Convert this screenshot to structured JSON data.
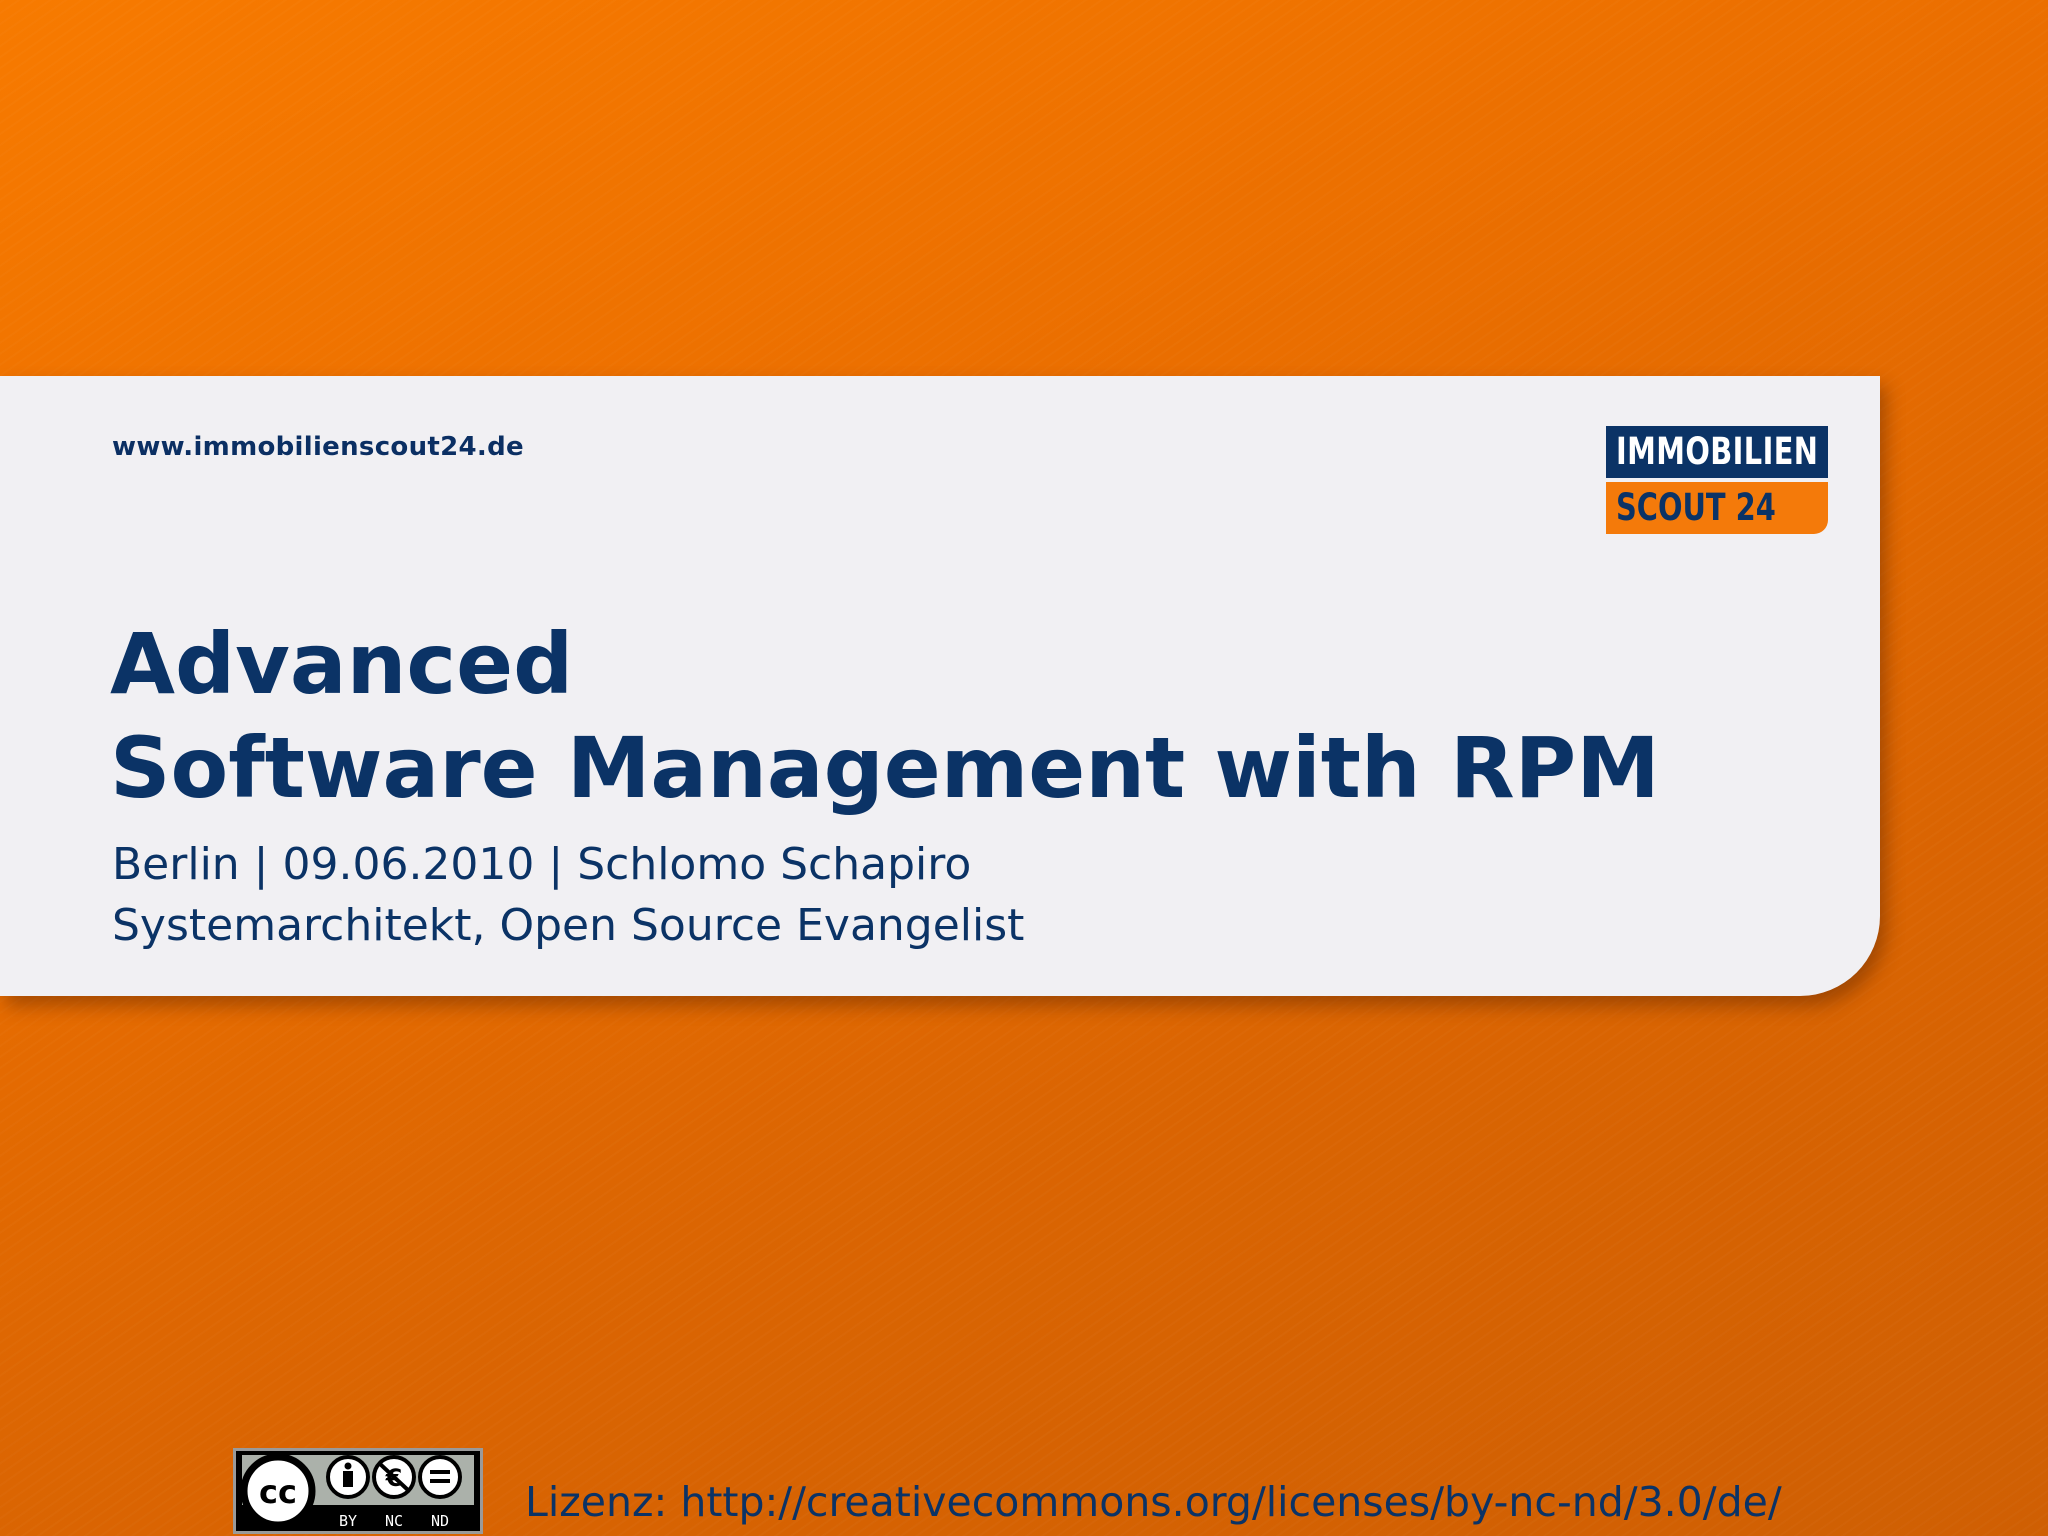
{
  "colors": {
    "background_orange": "#ea6e00",
    "card": "#f1f0f3",
    "navy": "#0b3366",
    "logo_orange": "#f47a0a"
  },
  "header": {
    "website": "www.immobilienscout24.de"
  },
  "logo": {
    "line1": "IMMOBILIEN",
    "line2": "SCOUT 24"
  },
  "title": {
    "line1": "Advanced",
    "line2": "Software Management with RPM"
  },
  "subtitle": {
    "line1": "Berlin | 09.06.2010 | Schlomo Schapiro",
    "line2": "Systemarchitekt, Open Source Evangelist"
  },
  "license_badge": {
    "cc": "cc",
    "by": "BY",
    "nc": "NC",
    "nd": "ND",
    "icons": [
      "creative-commons-icon",
      "attribution-icon",
      "non-commercial-icon",
      "no-derivatives-icon"
    ]
  },
  "footer": {
    "license_text": "Lizenz: http://creativecommons.org/licenses/by-nc-nd/3.0/de/"
  }
}
